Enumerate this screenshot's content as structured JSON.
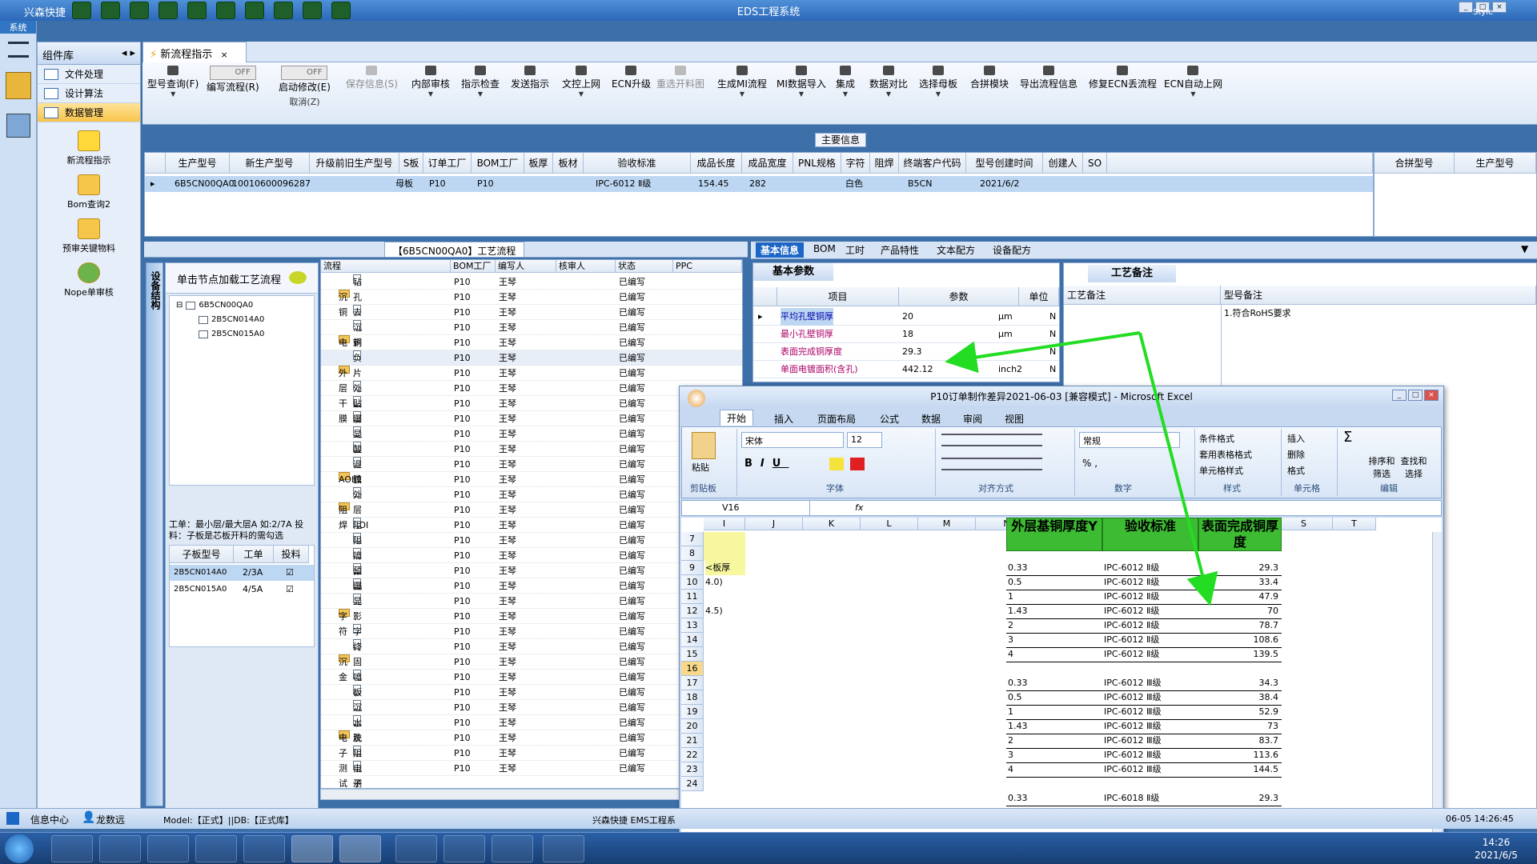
{
  "app": {
    "title": "EDS工程系统",
    "quick_label": "兴森快捷",
    "style_label": "Style",
    "system_label": "系统"
  },
  "complib": {
    "title": "组件库",
    "items": [
      {
        "label": "文件处理"
      },
      {
        "label": "设计算法"
      },
      {
        "label": "数据管理"
      }
    ],
    "icons": [
      {
        "label": "新流程指示"
      },
      {
        "label": "Bom查询2"
      },
      {
        "label": "预审关键物料"
      },
      {
        "label": "Nope单审核"
      }
    ]
  },
  "main_tab": {
    "label": "新流程指示"
  },
  "toolbar": {
    "buttons": [
      {
        "label": "型号查询(F)"
      },
      {
        "label": "编写流程(R)",
        "toggle": "OFF"
      },
      {
        "label": "启动修改(E)",
        "sub": "取消(Z)",
        "toggle": "OFF"
      },
      {
        "label": "保存信息(S)"
      },
      {
        "label": "内部审核"
      },
      {
        "label": "指示检查"
      },
      {
        "label": "发送指示"
      },
      {
        "label": "文控上网"
      },
      {
        "label": "ECN升级"
      },
      {
        "label": "重选开料图"
      },
      {
        "label": "生成MI流程"
      },
      {
        "label": "MI数据导入"
      },
      {
        "label": "集成"
      },
      {
        "label": "数据对比"
      },
      {
        "label": "选择母板"
      },
      {
        "label": "合拼模块"
      },
      {
        "label": "导出流程信息"
      },
      {
        "label": "修复ECN丢流程"
      },
      {
        "label": "ECN自动上网"
      }
    ]
  },
  "main_info": {
    "label": "主要信息",
    "headers": [
      "生产型号",
      "新生产型号",
      "升级前旧生产型号",
      "S板",
      "订单工厂",
      "BOM工厂",
      "板厚",
      "板材",
      "验收标准",
      "成品长度",
      "成品宽度",
      "PNL规格",
      "字符",
      "阻焊",
      "终端客户代码",
      "型号创建时间",
      "创建人",
      "SO"
    ],
    "row": {
      "prod_model": "6B5CN00QA0",
      "new_model": "10010600096287",
      "sboard": "母板",
      "order_factory": "P10",
      "bom_factory": "P10",
      "standard": "IPC-6012 Ⅱ级",
      "length": "154.45",
      "width": "282",
      "char": "白色",
      "customer": "B5CN",
      "created": "2021/6/2"
    },
    "right_headers": [
      "合拼型号",
      "生产型号"
    ]
  },
  "flow": {
    "title": "【6B5CN00QA0】工艺流程",
    "vtab": "设备结构",
    "hint": "单击节点加载工艺流程",
    "tree": [
      {
        "label": "6B5CN00QA0"
      },
      {
        "label": "2B5CN014A0"
      },
      {
        "label": "2B5CN015A0"
      }
    ],
    "note": "工单：最小层/最大层A 如:2/7A 投料：子板是芯板开料的需勾选",
    "sub_headers": [
      "子板型号",
      "工单",
      "投料"
    ],
    "sub_rows": [
      {
        "model": "2B5CN014A0",
        "order": "2/3A"
      },
      {
        "model": "2B5CN015A0",
        "order": "4/5A"
      }
    ],
    "headers": [
      "流程",
      "BOM工厂",
      "编写人",
      "核审人",
      "状态",
      "PPC"
    ],
    "rows": [
      {
        "name": "钻孔",
        "lvl": 2,
        "f": "P10",
        "w": "王琴",
        "s": "已编写"
      },
      {
        "name": "沉铜",
        "lvl": 1,
        "f": "P10",
        "w": "王琴",
        "s": "已编写"
      },
      {
        "name": "去毛刺",
        "lvl": 2,
        "f": "P10",
        "w": "王琴",
        "s": "已编写"
      },
      {
        "name": "沉铜",
        "lvl": 2,
        "f": "P10",
        "w": "王琴",
        "s": "已编写"
      },
      {
        "name": "电镀",
        "lvl": 1,
        "f": "P10",
        "w": "王琴",
        "s": "已编写"
      },
      {
        "name": "负片电镀",
        "lvl": 2,
        "f": "P10",
        "w": "王琴",
        "s": "已编写"
      },
      {
        "name": "外层干膜",
        "lvl": 1,
        "f": "P10",
        "w": "王琴",
        "s": "已编写"
      },
      {
        "name": "外层前处理",
        "lvl": 2,
        "f": "P10",
        "w": "王琴",
        "s": "已编写"
      },
      {
        "name": "贴膜",
        "lvl": 2,
        "f": "P10",
        "w": "王琴",
        "s": "已编写"
      },
      {
        "name": "曝光",
        "lvl": 2,
        "f": "P10",
        "w": "王琴",
        "s": "已编写"
      },
      {
        "name": "显影",
        "lvl": 2,
        "f": "P10",
        "w": "王琴",
        "s": "已编写"
      },
      {
        "name": "酸性蚀刻",
        "lvl": 2,
        "f": "P10",
        "w": "王琴",
        "s": "已编写"
      },
      {
        "name": "退膜",
        "lvl": 2,
        "f": "P10",
        "w": "王琴",
        "s": "已编写"
      },
      {
        "name": "AOI",
        "lvl": 1,
        "f": "P10",
        "w": "王琴",
        "s": "已编写"
      },
      {
        "name": "外层AOI",
        "lvl": 2,
        "f": "P10",
        "w": "王琴",
        "s": "已编写"
      },
      {
        "name": "阻焊",
        "lvl": 1,
        "f": "P10",
        "w": "王琴",
        "s": "已编写"
      },
      {
        "name": "阻焊前处理",
        "lvl": 2,
        "f": "P10",
        "w": "王琴",
        "s": "已编写"
      },
      {
        "name": "阻焊塞孔",
        "lvl": 2,
        "f": "P10",
        "w": "王琴",
        "s": "已编写"
      },
      {
        "name": "喷涂",
        "lvl": 2,
        "f": "P10",
        "w": "王琴",
        "s": "已编写"
      },
      {
        "name": "预烘",
        "lvl": 2,
        "f": "P10",
        "w": "王琴",
        "s": "已编写"
      },
      {
        "name": "曝光",
        "lvl": 2,
        "f": "P10",
        "w": "王琴",
        "s": "已编写"
      },
      {
        "name": "显影",
        "lvl": 2,
        "f": "P10",
        "w": "王琴",
        "s": "已编写"
      },
      {
        "name": "字符",
        "lvl": 1,
        "f": "P10",
        "w": "王琴",
        "s": "已编写"
      },
      {
        "name": "字符",
        "lvl": 2,
        "f": "P10",
        "w": "王琴",
        "s": "已编写"
      },
      {
        "name": "终固化",
        "lvl": 2,
        "f": "P10",
        "w": "王琴",
        "s": "已编写"
      },
      {
        "name": "沉金",
        "lvl": 1,
        "f": "P10",
        "w": "王琴",
        "s": "已编写"
      },
      {
        "name": "喷砂",
        "lvl": 2,
        "f": "P10",
        "w": "王琴",
        "s": "已编写"
      },
      {
        "name": "板边包胶",
        "lvl": 2,
        "f": "P10",
        "w": "王琴",
        "s": "已编写"
      },
      {
        "name": "沉金",
        "lvl": 2,
        "f": "P10",
        "w": "王琴",
        "s": "已编写"
      },
      {
        "name": "水洗烘干",
        "lvl": 2,
        "f": "P10",
        "w": "王琴",
        "s": "已编写"
      },
      {
        "name": "电子测试",
        "lvl": 1,
        "f": "P10",
        "w": "王琴",
        "s": "已编写"
      },
      {
        "name": "阻抗测试",
        "lvl": 2,
        "f": "P10",
        "w": "王琴",
        "s": "已编写"
      },
      {
        "name": "电子测试",
        "lvl": 2,
        "f": "P10",
        "w": "王琴",
        "s": "已编写"
      }
    ]
  },
  "basic": {
    "tabs": [
      "基本信息",
      "BOM",
      "工时",
      "产品特性",
      "文本配方",
      "设备配方"
    ],
    "section": "基本参数",
    "headers": [
      "项目",
      "参数",
      "单位"
    ],
    "rows": [
      {
        "item": "平均孔壁铜厚",
        "value": "20",
        "unit": "μm",
        "flag": "N"
      },
      {
        "item": "最小孔壁铜厚",
        "value": "18",
        "unit": "μm",
        "flag": "N"
      },
      {
        "item": "表面完成铜厚度",
        "value": "29.3",
        "unit": "",
        "flag": "N"
      },
      {
        "item": "单面电镀面积(含孔)",
        "value": "442.12",
        "unit": "inch2",
        "flag": "N"
      }
    ]
  },
  "process_note": {
    "section": "工艺备注",
    "col1": "工艺备注",
    "col2": "型号备注",
    "note": "1.符合RoHS要求"
  },
  "excel": {
    "title": "P10订单制作差异2021-06-03  [兼容模式] - Microsoft Excel",
    "tabs": [
      "开始",
      "插入",
      "页面布局",
      "公式",
      "数据",
      "审阅",
      "视图"
    ],
    "font": "宋体",
    "size": "12",
    "numfmt": "常规",
    "cellref": "V16",
    "groups": [
      "剪贴板",
      "字体",
      "对齐方式",
      "数字",
      "样式",
      "单元格",
      "编辑"
    ],
    "ribbon_btns": {
      "paste": "粘贴",
      "cond": "条件格式",
      "tbl": "套用表格格式",
      "cellstyle": "单元格样式",
      "insert": "插入",
      "delete": "删除",
      "format": "格式",
      "sort": "排序和筛选",
      "find": "查找和选择"
    },
    "cols": [
      "I",
      "J",
      "K",
      "L",
      "M",
      "N",
      "O",
      "P",
      "Q",
      "R",
      "S",
      "T"
    ],
    "row_nums": [
      "7",
      "8",
      "9",
      "10",
      "11",
      "12",
      "13",
      "14",
      "15",
      "16",
      "17",
      "18",
      "19",
      "20",
      "21",
      "22",
      "23",
      "24"
    ],
    "hdr_n": "外层基铜厚度Y",
    "hdr_p": "验收标准",
    "hdr_q": "表面完成铜厚度",
    "i_cells": [
      "<板厚",
      "4.0)",
      "4.5)"
    ],
    "data": [
      {
        "r": 9,
        "n": "0.33",
        "p": "IPC-6012 Ⅱ级",
        "q": "29.3"
      },
      {
        "r": 10,
        "n": "0.5",
        "p": "IPC-6012 Ⅱ级",
        "q": "33.4"
      },
      {
        "r": 11,
        "n": "1",
        "p": "IPC-6012 Ⅱ级",
        "q": "47.9"
      },
      {
        "r": 12,
        "n": "1.43",
        "p": "IPC-6012 Ⅱ级",
        "q": "70"
      },
      {
        "r": 13,
        "n": "2",
        "p": "IPC-6012 Ⅱ级",
        "q": "78.7"
      },
      {
        "r": 14,
        "n": "3",
        "p": "IPC-6012 Ⅱ级",
        "q": "108.6"
      },
      {
        "r": 15,
        "n": "4",
        "p": "IPC-6012 Ⅱ级",
        "q": "139.5"
      },
      {
        "r": 17,
        "n": "0.33",
        "p": "IPC-6012 Ⅲ级",
        "q": "34.3"
      },
      {
        "r": 18,
        "n": "0.5",
        "p": "IPC-6012 Ⅲ级",
        "q": "38.4"
      },
      {
        "r": 19,
        "n": "1",
        "p": "IPC-6012 Ⅲ级",
        "q": "52.9"
      },
      {
        "r": 20,
        "n": "1.43",
        "p": "IPC-6012 Ⅲ级",
        "q": "73"
      },
      {
        "r": 21,
        "n": "2",
        "p": "IPC-6012 Ⅲ级",
        "q": "83.7"
      },
      {
        "r": 22,
        "n": "3",
        "p": "IPC-6012 Ⅲ级",
        "q": "113.6"
      },
      {
        "r": 23,
        "n": "4",
        "p": "IPC-6012 Ⅲ级",
        "q": "144.5"
      },
      {
        "r": 25,
        "n": "0.33",
        "p": "IPC-6018 Ⅱ级",
        "q": "29.3"
      }
    ]
  },
  "status": {
    "info_center": "信息中心",
    "user": "龙数远",
    "model_db": "Model:【正式】||DB:【正式库】",
    "company": "兴森快捷  EMS工程系",
    "time": "06-05 14:26:45"
  },
  "taskbar": {
    "time": "14:26",
    "date": "2021/6/5"
  },
  "colors": {
    "accent": "#1c66c6",
    "annotation": "#22dd22",
    "selection": "#bdd7f3"
  }
}
